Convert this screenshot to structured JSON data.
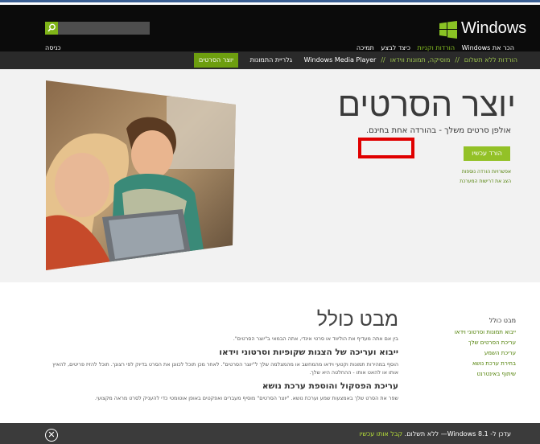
{
  "header": {
    "brand": "Windows",
    "nav": [
      "הכר את Windows",
      "הורדות וקניות",
      "כיצד לבצע",
      "תמיכה"
    ],
    "signin": "כניסה",
    "search": {
      "placeholder": ""
    }
  },
  "subnav": {
    "items": [
      "הורדות ללא תשלום",
      "מוסיקה, תמונות ווידאו",
      "Windows Media Player",
      "גלריית התמונות",
      "יוצר הסרטים"
    ],
    "separator": "//"
  },
  "hero": {
    "title": "יוצר הסרטים",
    "subtitle": "אולפן סרטים משלך - בהורדה אחת בחינם.",
    "download_label": "הורד עכשיו",
    "more_options": "אפשרויות הורדה נוספות",
    "system_requirements": "הצג את דרישות המערכת"
  },
  "sidebar": {
    "title": "מבט כולל",
    "items": [
      "ייבוא תמונות וסרטוני וידאו",
      "עריכת הסרטים שלך",
      "עריכת השמע",
      "בחירת ערכת נושא",
      "שיתוף באינטרנט"
    ]
  },
  "main": {
    "title": "מבט כולל",
    "intro": "בין אם אתה מעדיף את הוליווד או סרטי אינדי, אתה הבמאי ב\"יוצר הסרטים\".",
    "section1_title": "ייבוא ועריכה של הצגות שקופיות וסרטוני וידאו",
    "section1_text": "הוסף במהירות תמונות וקטעי וידאו מהמחשב או מהמצלמה שלך ל\"יוצר הסרטים\". לאחר מכן תוכל לכוונן את הסרט בדיוק לפי רצונך. תוכל להזיז פריטים, להאיץ אותו או להאט אותו - ההחלטה היא שלך.",
    "section2_title": "עריכת הפסקול והוספת ערכת נושא",
    "section2_text": "שפר את הסרט שלך באמצעות שמע וערכת נושא. \"יוצר הסרטים\" מוסיף מעברים ואפקטים באופן אוטומטי כדי להעניק לסרט מראה מקצועי."
  },
  "banner": {
    "text": "עדכן ל- Windows 8.1— ללא תשלום.",
    "link": "קבל אותו עכשיו",
    "close": "✕"
  },
  "colors": {
    "accent": "#8ac324",
    "header_bg": "#0b0b0b",
    "alert_box": "#e00000"
  }
}
